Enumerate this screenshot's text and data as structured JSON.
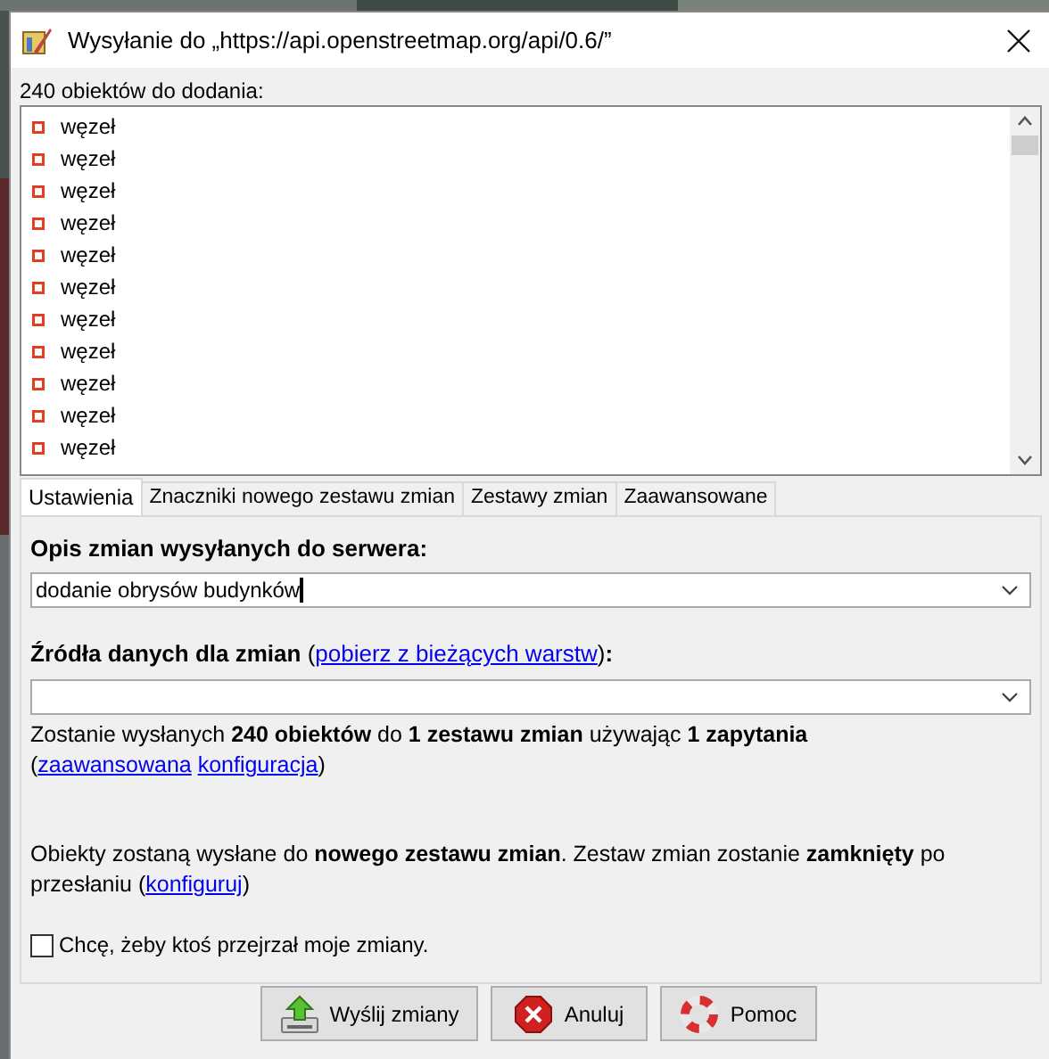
{
  "window": {
    "title": "Wysyłanie do „https://api.openstreetmap.org/api/0.6/”"
  },
  "list_label": "240 obiektów do dodania:",
  "objects": [
    {
      "label": "węzeł"
    },
    {
      "label": "węzeł"
    },
    {
      "label": "węzeł"
    },
    {
      "label": "węzeł"
    },
    {
      "label": "węzeł"
    },
    {
      "label": "węzeł"
    },
    {
      "label": "węzeł"
    },
    {
      "label": "węzeł"
    },
    {
      "label": "węzeł"
    },
    {
      "label": "węzeł"
    },
    {
      "label": "węzeł"
    }
  ],
  "tabs": [
    {
      "label": "Ustawienia",
      "selected": true
    },
    {
      "label": "Znaczniki nowego zestawu zmian",
      "selected": false
    },
    {
      "label": "Zestawy zmian",
      "selected": false
    },
    {
      "label": "Zaawansowane",
      "selected": false
    }
  ],
  "description": {
    "label": "Opis zmian wysyłanych do serwera:",
    "value": "dodanie obrysów budynków"
  },
  "sources_label": [
    {
      "kind": "text",
      "text": "**Źródła danych dla zmian** ("
    },
    {
      "kind": "link",
      "text": "pobierz z bieżących warstw"
    },
    {
      "kind": "text",
      "text": ")**:**"
    }
  ],
  "summary": [
    {
      "kind": "text",
      "text": "Zostanie wysłanych **240 obiektów** do **1 zestawu zmian** używając **1 zapytania** ("
    },
    {
      "kind": "link",
      "text": "zaawansowana"
    },
    {
      "kind": "space"
    },
    {
      "kind": "link",
      "text": "konfiguracja"
    },
    {
      "kind": "text",
      "text": ")"
    }
  ],
  "changeset_info": [
    {
      "kind": "text",
      "text": "Obiekty zostaną wysłane do **nowego zestawu zmian**. Zestaw zmian zostanie **zamknięty** po przesłaniu ("
    },
    {
      "kind": "link",
      "text": "konfiguruj"
    },
    {
      "kind": "text",
      "text": ")"
    }
  ],
  "review": {
    "label": "Chcę, żeby ktoś przejrzał moje zmiany.",
    "checked": false
  },
  "buttons": [
    {
      "kind": "upload",
      "label": "Wyślij zmiany"
    },
    {
      "kind": "cancel",
      "label": "Anuluj"
    },
    {
      "kind": "help",
      "label": "Pomoc"
    }
  ]
}
